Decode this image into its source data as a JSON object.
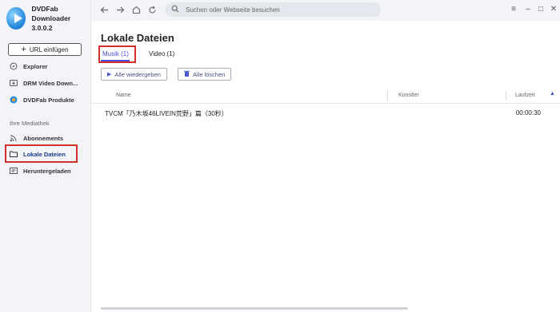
{
  "app": {
    "name_line1": "DVDFab Downloader",
    "name_line2": "3.0.0.2"
  },
  "sidebar": {
    "url_button": "URL einfügen",
    "items": [
      {
        "label": "Explorer",
        "icon": "compass-icon"
      },
      {
        "label": "DRM Video Down...",
        "icon": "video-download-icon"
      },
      {
        "label": "DVDFab Produkte",
        "icon": "dvdfab-logo-icon"
      }
    ],
    "library_label": "Ihre Mediathek",
    "library_items": [
      {
        "label": "Abonnements",
        "icon": "rss-icon"
      },
      {
        "label": "Lokale Dateien",
        "icon": "folder-icon",
        "active": true
      },
      {
        "label": "Heruntergeladen",
        "icon": "downloaded-icon"
      }
    ]
  },
  "topbar": {
    "search_placeholder": "Suchen oder Webseite besuchen"
  },
  "main": {
    "title": "Lokale Dateien",
    "tabs": [
      {
        "label": "Musik (1)",
        "active": true
      },
      {
        "label": "Video (1)",
        "active": false
      }
    ],
    "play_all": "Alle wiedergeben",
    "delete_all": "Alle löschen",
    "columns": {
      "name": "Name",
      "artist": "Künstler",
      "duration": "Laufzeit"
    },
    "rows": [
      {
        "name": "TVCM「乃木坂46LIVEIN荒野」篇（30秒）",
        "artist": "",
        "duration": "00:00:30"
      }
    ]
  },
  "colors": {
    "accent": "#4a4fd8",
    "highlight": "#d32f2f",
    "sidebar_bg": "#f2f4f8"
  }
}
